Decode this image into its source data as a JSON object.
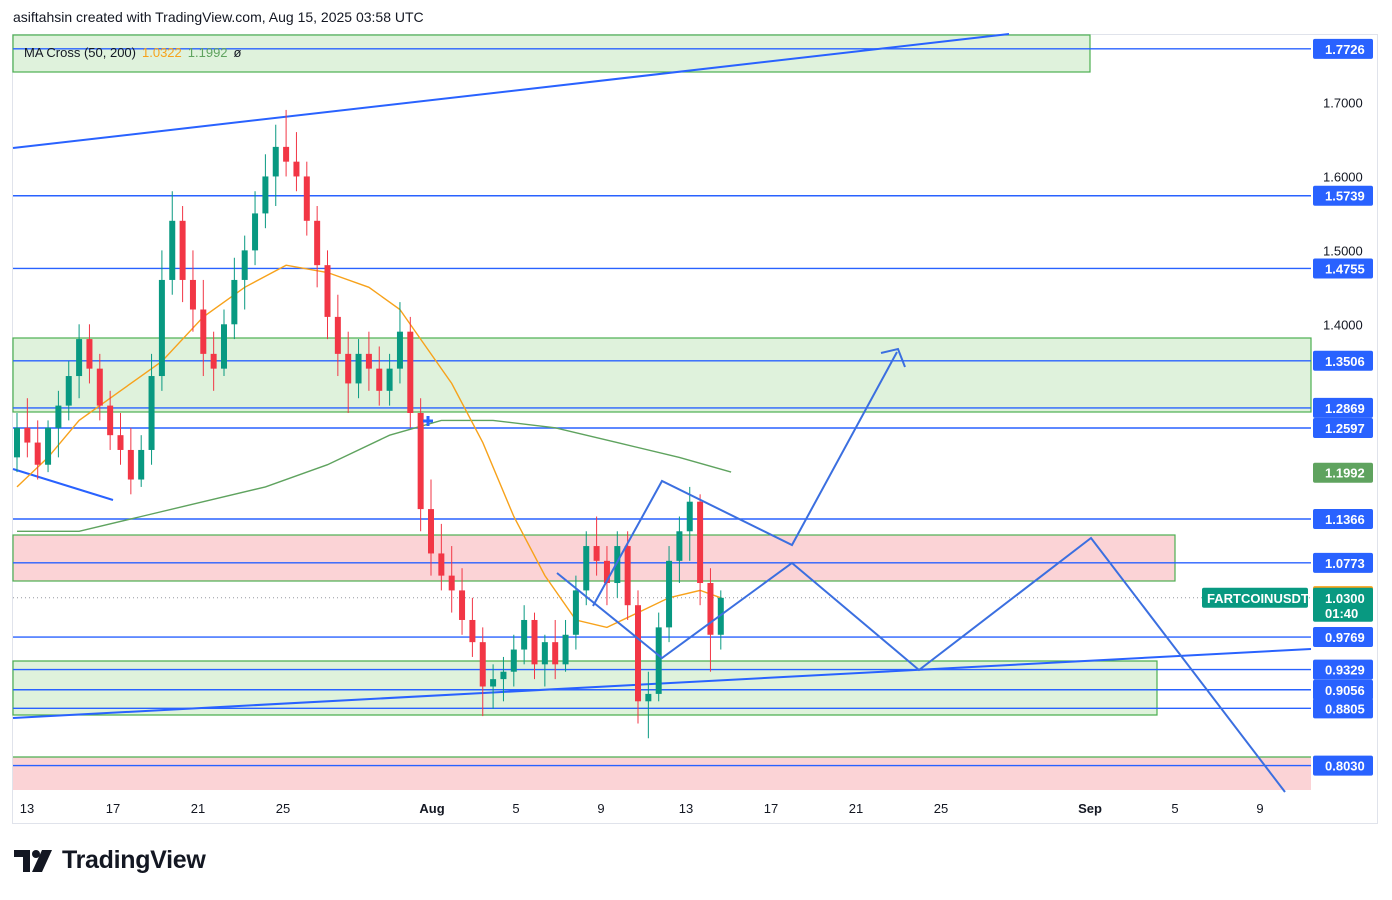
{
  "header": {
    "text": "asiftahsin created with TradingView.com, Aug 15, 2025 03:58 UTC"
  },
  "indicator": {
    "name": "MA Cross (50, 200)",
    "fast_value": "1.0322",
    "slow_value": "1.1992",
    "symbol": "ø"
  },
  "symbol_tag": {
    "label": "FARTCOINUSDT",
    "price": "1.0300",
    "countdown": "01:40"
  },
  "logo": {
    "text": "TradingView"
  },
  "colors": {
    "up": "#089981",
    "down": "#f23645",
    "level_line": "#2962ff",
    "drawing": "#3b6fe0",
    "ma_fast": "#f7a21b",
    "ma_slow": "#5fa35f",
    "support_zone": "#dff2dc",
    "support_border": "#4caf50",
    "resistance_zone": "#fbd3d6"
  },
  "chart_data": {
    "type": "candlestick",
    "y_axis": {
      "min": 0.77,
      "max": 1.79,
      "ticks": [
        "1.7000",
        "1.6000",
        "1.5000",
        "1.4000"
      ]
    },
    "x_axis": {
      "tick_labels": [
        "13",
        "17",
        "21",
        "25",
        "Aug",
        "5",
        "9",
        "13",
        "17",
        "21",
        "25",
        "Sep",
        "5",
        "9"
      ]
    },
    "price_levels": [
      {
        "value": 1.7726,
        "label": "1.7726"
      },
      {
        "value": 1.5739,
        "label": "1.5739"
      },
      {
        "value": 1.4755,
        "label": "1.4755"
      },
      {
        "value": 1.3506,
        "label": "1.3506"
      },
      {
        "value": 1.2869,
        "label": "1.2869"
      },
      {
        "value": 1.2597,
        "label": "1.2597"
      },
      {
        "value": 1.1366,
        "label": "1.1366"
      },
      {
        "value": 1.0773,
        "label": "1.0773"
      },
      {
        "value": 0.9769,
        "label": "0.9769"
      },
      {
        "value": 0.9329,
        "label": "0.9329"
      },
      {
        "value": 0.9056,
        "label": "0.9056"
      },
      {
        "value": 0.8805,
        "label": "0.8805"
      },
      {
        "value": 0.803,
        "label": "0.8030"
      }
    ],
    "ma_labels": [
      {
        "name": "MA 200",
        "value": "1.1992"
      },
      {
        "name": "MA 50",
        "value": "1.0322"
      }
    ],
    "last_price": {
      "value": 1.03,
      "label": "1.0300"
    },
    "candles": [
      [
        1.22,
        1.28,
        1.2,
        1.26
      ],
      [
        1.26,
        1.3,
        1.22,
        1.24
      ],
      [
        1.24,
        1.27,
        1.19,
        1.21
      ],
      [
        1.21,
        1.27,
        1.2,
        1.26
      ],
      [
        1.26,
        1.31,
        1.22,
        1.29
      ],
      [
        1.29,
        1.35,
        1.27,
        1.33
      ],
      [
        1.33,
        1.4,
        1.3,
        1.38
      ],
      [
        1.38,
        1.4,
        1.32,
        1.34
      ],
      [
        1.34,
        1.36,
        1.27,
        1.29
      ],
      [
        1.29,
        1.31,
        1.23,
        1.25
      ],
      [
        1.25,
        1.28,
        1.21,
        1.23
      ],
      [
        1.23,
        1.26,
        1.17,
        1.19
      ],
      [
        1.19,
        1.25,
        1.18,
        1.23
      ],
      [
        1.23,
        1.36,
        1.21,
        1.33
      ],
      [
        1.33,
        1.5,
        1.31,
        1.46
      ],
      [
        1.46,
        1.58,
        1.44,
        1.54
      ],
      [
        1.54,
        1.56,
        1.43,
        1.46
      ],
      [
        1.46,
        1.5,
        1.39,
        1.42
      ],
      [
        1.42,
        1.46,
        1.33,
        1.36
      ],
      [
        1.36,
        1.39,
        1.31,
        1.34
      ],
      [
        1.34,
        1.42,
        1.33,
        1.4
      ],
      [
        1.4,
        1.49,
        1.38,
        1.46
      ],
      [
        1.46,
        1.52,
        1.42,
        1.5
      ],
      [
        1.5,
        1.58,
        1.48,
        1.55
      ],
      [
        1.55,
        1.63,
        1.53,
        1.6
      ],
      [
        1.6,
        1.67,
        1.56,
        1.64
      ],
      [
        1.64,
        1.69,
        1.6,
        1.62
      ],
      [
        1.62,
        1.66,
        1.58,
        1.6
      ],
      [
        1.6,
        1.62,
        1.52,
        1.54
      ],
      [
        1.54,
        1.56,
        1.45,
        1.48
      ],
      [
        1.48,
        1.5,
        1.38,
        1.41
      ],
      [
        1.41,
        1.44,
        1.33,
        1.36
      ],
      [
        1.36,
        1.39,
        1.28,
        1.32
      ],
      [
        1.32,
        1.38,
        1.3,
        1.36
      ],
      [
        1.36,
        1.39,
        1.31,
        1.34
      ],
      [
        1.34,
        1.37,
        1.29,
        1.31
      ],
      [
        1.31,
        1.36,
        1.29,
        1.34
      ],
      [
        1.34,
        1.43,
        1.32,
        1.39
      ],
      [
        1.39,
        1.41,
        1.26,
        1.28
      ],
      [
        1.28,
        1.3,
        1.12,
        1.15
      ],
      [
        1.15,
        1.19,
        1.06,
        1.09
      ],
      [
        1.09,
        1.13,
        1.04,
        1.06
      ],
      [
        1.06,
        1.1,
        1.01,
        1.04
      ],
      [
        1.04,
        1.07,
        0.98,
        1.0
      ],
      [
        1.0,
        1.03,
        0.95,
        0.97
      ],
      [
        0.97,
        0.99,
        0.87,
        0.91
      ],
      [
        0.91,
        0.94,
        0.88,
        0.92
      ],
      [
        0.92,
        0.95,
        0.89,
        0.93
      ],
      [
        0.93,
        0.98,
        0.91,
        0.96
      ],
      [
        0.96,
        1.02,
        0.94,
        1.0
      ],
      [
        1.0,
        1.01,
        0.92,
        0.94
      ],
      [
        0.94,
        0.98,
        0.91,
        0.97
      ],
      [
        0.97,
        1.0,
        0.92,
        0.94
      ],
      [
        0.94,
        1.0,
        0.93,
        0.98
      ],
      [
        0.98,
        1.06,
        0.96,
        1.04
      ],
      [
        1.04,
        1.12,
        1.02,
        1.1
      ],
      [
        1.1,
        1.14,
        1.06,
        1.08
      ],
      [
        1.08,
        1.1,
        1.02,
        1.05
      ],
      [
        1.05,
        1.12,
        1.03,
        1.1
      ],
      [
        1.1,
        1.12,
        1.0,
        1.02
      ],
      [
        1.02,
        1.04,
        0.86,
        0.89
      ],
      [
        0.89,
        0.93,
        0.84,
        0.9
      ],
      [
        0.9,
        1.01,
        0.89,
        0.99
      ],
      [
        0.99,
        1.1,
        0.97,
        1.08
      ],
      [
        1.08,
        1.14,
        1.05,
        1.12
      ],
      [
        1.12,
        1.18,
        1.08,
        1.16
      ],
      [
        1.16,
        1.17,
        1.02,
        1.05
      ],
      [
        1.05,
        1.07,
        0.93,
        0.98
      ],
      [
        0.98,
        1.04,
        0.96,
        1.03
      ]
    ],
    "ma50": [
      [
        0,
        1.18
      ],
      [
        3,
        1.22
      ],
      [
        6,
        1.27
      ],
      [
        10,
        1.31
      ],
      [
        14,
        1.35
      ],
      [
        18,
        1.41
      ],
      [
        22,
        1.45
      ],
      [
        26,
        1.48
      ],
      [
        30,
        1.47
      ],
      [
        34,
        1.45
      ],
      [
        37,
        1.42
      ],
      [
        39,
        1.38
      ],
      [
        42,
        1.32
      ],
      [
        45,
        1.24
      ],
      [
        48,
        1.14
      ],
      [
        51,
        1.06
      ],
      [
        54,
        1.0
      ],
      [
        57,
        0.99
      ],
      [
        60,
        1.01
      ],
      [
        63,
        1.03
      ],
      [
        66,
        1.04
      ],
      [
        68,
        1.03
      ]
    ],
    "ma200": [
      [
        0,
        1.12
      ],
      [
        6,
        1.12
      ],
      [
        12,
        1.14
      ],
      [
        18,
        1.16
      ],
      [
        24,
        1.18
      ],
      [
        30,
        1.21
      ],
      [
        36,
        1.25
      ],
      [
        41,
        1.27
      ],
      [
        46,
        1.27
      ],
      [
        52,
        1.26
      ],
      [
        58,
        1.24
      ],
      [
        64,
        1.22
      ],
      [
        69,
        1.2
      ]
    ]
  }
}
